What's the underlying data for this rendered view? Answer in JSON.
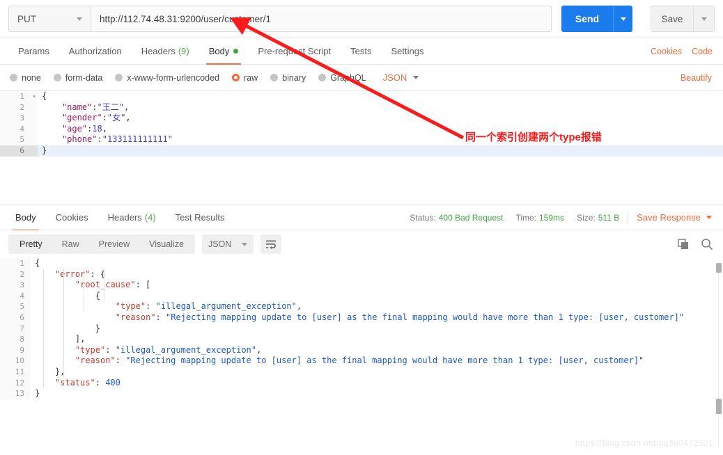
{
  "request": {
    "method": "PUT",
    "url": "http://112.74.48.31:9200/user/customer/1",
    "send_label": "Send",
    "save_label": "Save",
    "tabs": [
      {
        "label": "Params",
        "count": "",
        "active": false,
        "dot": false
      },
      {
        "label": "Authorization",
        "count": "",
        "active": false,
        "dot": false
      },
      {
        "label": "Headers",
        "count": "(9)",
        "active": false,
        "dot": false
      },
      {
        "label": "Body",
        "count": "",
        "active": true,
        "dot": true
      },
      {
        "label": "Pre-request Script",
        "count": "",
        "active": false,
        "dot": false
      },
      {
        "label": "Tests",
        "count": "",
        "active": false,
        "dot": false
      },
      {
        "label": "Settings",
        "count": "",
        "active": false,
        "dot": false
      }
    ],
    "tab_links": [
      {
        "label": "Cookies"
      },
      {
        "label": "Code"
      }
    ],
    "body_types": [
      {
        "label": "none",
        "selected": false
      },
      {
        "label": "form-data",
        "selected": false
      },
      {
        "label": "x-www-form-urlencoded",
        "selected": false
      },
      {
        "label": "raw",
        "selected": true
      },
      {
        "label": "binary",
        "selected": false
      },
      {
        "label": "GraphQL",
        "selected": false
      }
    ],
    "format": "JSON",
    "beautify_label": "Beautify",
    "body_lines": [
      {
        "num": "1",
        "fold": "▾",
        "text": "{",
        "highlight": false
      },
      {
        "num": "2",
        "fold": "",
        "text": "    \"name\":\"王二\",",
        "highlight": false
      },
      {
        "num": "3",
        "fold": "",
        "text": "    \"gender\":\"女\",",
        "highlight": false
      },
      {
        "num": "4",
        "fold": "",
        "text": "    \"age\":18,",
        "highlight": false
      },
      {
        "num": "5",
        "fold": "",
        "text": "    \"phone\":\"133111111111\"",
        "highlight": false
      },
      {
        "num": "6",
        "fold": "",
        "text": "}",
        "highlight": true
      }
    ]
  },
  "response": {
    "tabs": [
      {
        "label": "Body",
        "count": "",
        "active": true
      },
      {
        "label": "Cookies",
        "count": "",
        "active": false
      },
      {
        "label": "Headers",
        "count": "(4)",
        "active": false
      },
      {
        "label": "Test Results",
        "count": "",
        "active": false
      }
    ],
    "status_label": "Status:",
    "status_value": "400 Bad Request",
    "time_label": "Time:",
    "time_value": "159ms",
    "size_label": "Size:",
    "size_value": "511 B",
    "save_response_label": "Save Response",
    "view_modes": [
      {
        "label": "Pretty",
        "active": true
      },
      {
        "label": "Raw",
        "active": false
      },
      {
        "label": "Preview",
        "active": false
      },
      {
        "label": "Visualize",
        "active": false
      }
    ],
    "format": "JSON",
    "body_lines": [
      {
        "num": "1",
        "text": "{"
      },
      {
        "num": "2",
        "text": "    \"error\": {"
      },
      {
        "num": "3",
        "text": "        \"root_cause\": ["
      },
      {
        "num": "4",
        "text": "            {"
      },
      {
        "num": "5",
        "text": "                \"type\": \"illegal_argument_exception\","
      },
      {
        "num": "6",
        "text": "                \"reason\": \"Rejecting mapping update to [user] as the final mapping would have more than 1 type: [user, customer]\""
      },
      {
        "num": "7",
        "text": "            }"
      },
      {
        "num": "8",
        "text": "        ],"
      },
      {
        "num": "9",
        "text": "        \"type\": \"illegal_argument_exception\","
      },
      {
        "num": "10",
        "text": "        \"reason\": \"Rejecting mapping update to [user] as the final mapping would have more than 1 type: [user, customer]\""
      },
      {
        "num": "11",
        "text": "    },"
      },
      {
        "num": "12",
        "text": "    \"status\": 400"
      },
      {
        "num": "13",
        "text": "}"
      }
    ]
  },
  "annotation": {
    "text": "同一个索引创建两个type报错",
    "color": "#fc1a1a"
  },
  "watermark": "https://blog.csdn.net/qq360472521",
  "colors": {
    "accent_orange": "#f26b3a",
    "send_blue": "#1a7ced",
    "status_green": "#3fa540"
  }
}
